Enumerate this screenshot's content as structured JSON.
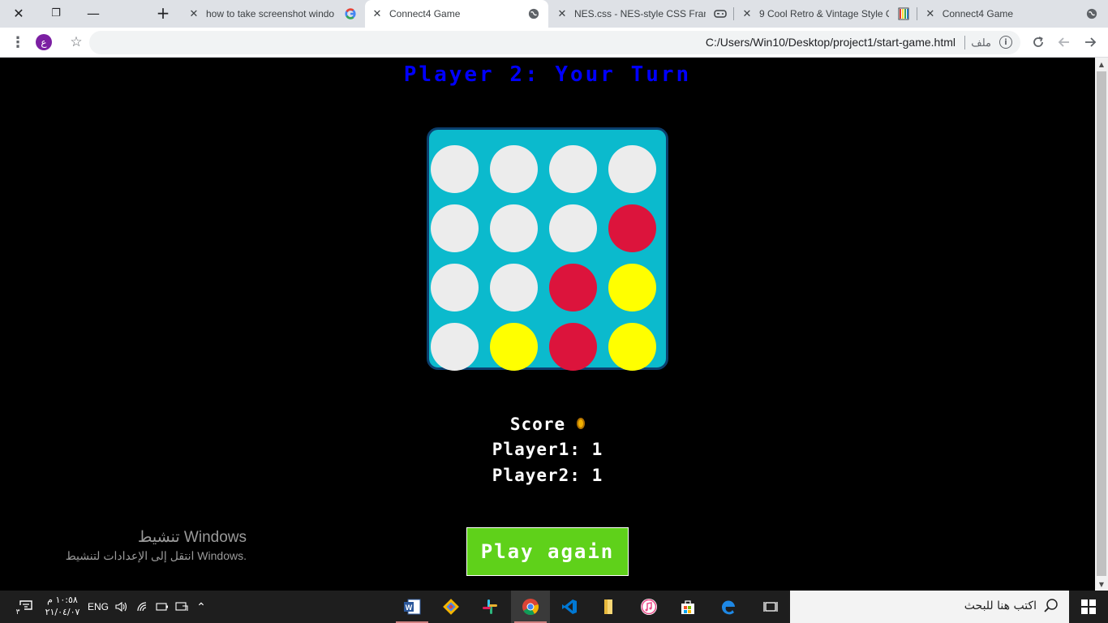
{
  "browser": {
    "tabs": [
      {
        "title": "how to take screenshot windo",
        "favicon": "google-icon"
      },
      {
        "title": "Connect4 Game",
        "favicon": "globe-icon",
        "active": true
      },
      {
        "title": "NES.css - NES-style CSS Frame",
        "favicon": "controller-icon"
      },
      {
        "title": "9 Cool Retro & Vintage Style C",
        "favicon": "palette-icon"
      },
      {
        "title": "Connect4 Game",
        "favicon": "globe-icon"
      }
    ],
    "url": "C:/Users/Win10/Desktop/project1/start-game.html",
    "file_label": "ملف",
    "profile_initial": "ع"
  },
  "game": {
    "turn_text": "Player 2: Your Turn",
    "board": [
      [
        "empty",
        "empty",
        "empty",
        "empty"
      ],
      [
        "empty",
        "empty",
        "empty",
        "red"
      ],
      [
        "empty",
        "empty",
        "red",
        "yellow"
      ],
      [
        "empty",
        "yellow",
        "red",
        "yellow"
      ]
    ],
    "colors": {
      "board": "#0bbacd",
      "empty": "#ececec",
      "red": "#dc143c",
      "yellow": "#ffff00",
      "turn": "#0000ff",
      "button": "#5fd11a"
    },
    "score_title": "Score",
    "player1_score": "Player1: 1",
    "player2_score": "Player2: 1",
    "play_again_label": "Play again"
  },
  "watermark": {
    "line1": "تنشيط Windows",
    "line2": "انتقل إلى الإعدادات لتنشيط Windows."
  },
  "taskbar": {
    "time": "١٠:٥٨ م",
    "date": "٢١/٠٤/٠٧",
    "language": "ENG",
    "search_placeholder": "اكتب هنا للبحث",
    "notification_count": "٣"
  }
}
